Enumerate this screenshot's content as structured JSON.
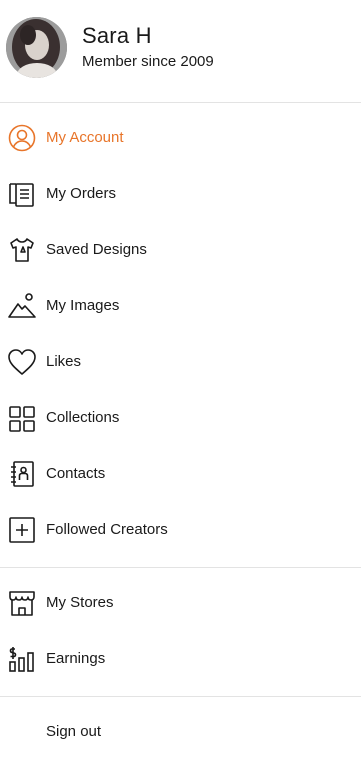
{
  "profile": {
    "name": "Sara H",
    "member_since": "Member since 2009",
    "avatar_icon": "avatar-photo"
  },
  "colors": {
    "accent": "#e8752a",
    "text": "#1a1a1a",
    "divider": "#e3e3e3"
  },
  "menu": {
    "primary": [
      {
        "label": "My Account",
        "icon": "user-circle-icon",
        "active": true
      },
      {
        "label": "My Orders",
        "icon": "orders-icon",
        "active": false
      },
      {
        "label": "Saved Designs",
        "icon": "shirt-icon",
        "active": false
      },
      {
        "label": "My Images",
        "icon": "image-icon",
        "active": false
      },
      {
        "label": "Likes",
        "icon": "heart-icon",
        "active": false
      },
      {
        "label": "Collections",
        "icon": "grid-icon",
        "active": false
      },
      {
        "label": "Contacts",
        "icon": "address-book-icon",
        "active": false
      },
      {
        "label": "Followed Creators",
        "icon": "plus-square-icon",
        "active": false
      }
    ],
    "secondary": [
      {
        "label": "My Stores",
        "icon": "store-icon",
        "active": false
      },
      {
        "label": "Earnings",
        "icon": "earnings-icon",
        "active": false
      }
    ]
  },
  "signout_label": "Sign out"
}
